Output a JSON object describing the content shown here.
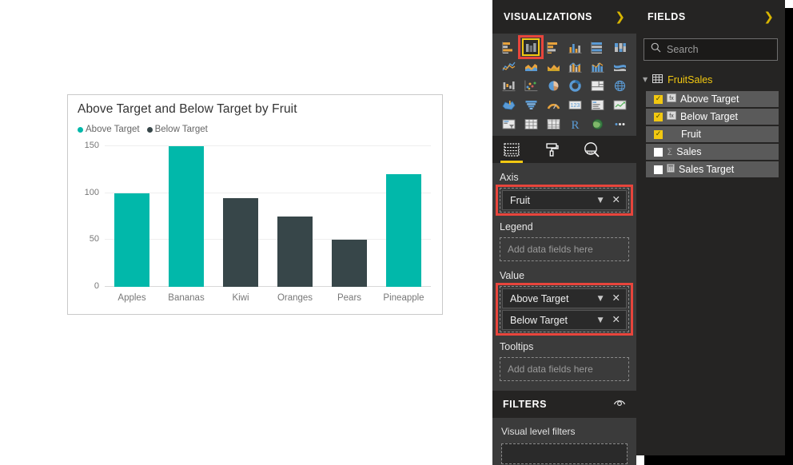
{
  "chart_card": {
    "title": "Above Target and Below Target by Fruit",
    "legend": [
      {
        "label": "Above Target",
        "color": "#01b8aa"
      },
      {
        "label": "Below Target",
        "color": "#374649"
      }
    ]
  },
  "chart_data": {
    "type": "bar",
    "title": "Above Target and Below Target by Fruit",
    "xlabel": "",
    "ylabel": "",
    "categories": [
      "Apples",
      "Bananas",
      "Kiwi",
      "Oranges",
      "Pears",
      "Pineapple"
    ],
    "values": [
      100,
      150,
      95,
      75,
      50,
      120
    ],
    "point_series": [
      "Above Target",
      "Above Target",
      "Below Target",
      "Below Target",
      "Below Target",
      "Above Target"
    ],
    "series": [
      {
        "name": "Above Target",
        "color": "#01b8aa",
        "values": [
          100,
          150,
          null,
          null,
          null,
          120
        ]
      },
      {
        "name": "Below Target",
        "color": "#374649",
        "values": [
          null,
          null,
          95,
          75,
          50,
          null
        ]
      }
    ],
    "ylim": [
      0,
      150
    ],
    "yticks": [
      0,
      50,
      100,
      150
    ],
    "ytick_labels": [
      "0",
      "50",
      "100",
      "150"
    ],
    "grid": true,
    "legend_position": "top-left"
  },
  "visualizations": {
    "header": "VISUALIZATIONS",
    "expand_icon": "chevron-right-icon",
    "selected_index": 1,
    "selected_name": "clustered-column-chart",
    "icons": [
      "stacked-bar-chart",
      "clustered-column-chart",
      "clustered-bar-chart",
      "stacked-column-chart",
      "hundred-percent-stacked-bar-chart",
      "hundred-percent-stacked-column-chart",
      "line-chart",
      "area-chart",
      "stacked-area-chart",
      "line-and-stacked-column-chart",
      "line-and-clustered-column-chart",
      "ribbon-chart",
      "waterfall-chart",
      "scatter-chart",
      "pie-chart",
      "donut-chart",
      "treemap",
      "map",
      "filled-map",
      "funnel",
      "gauge",
      "card",
      "multi-row-card",
      "kpi",
      "slicer",
      "table",
      "matrix",
      "r-script-visual",
      "arcgis-map",
      "more-options"
    ],
    "well_tabs": [
      {
        "name": "fields-tab",
        "icon": "fields-icon",
        "active": true
      },
      {
        "name": "format-tab",
        "icon": "paint-roller-icon",
        "active": false
      },
      {
        "name": "analytics-tab",
        "icon": "analytics-magnifier-icon",
        "active": false
      }
    ],
    "wells": [
      {
        "label": "Axis",
        "highlighted": true,
        "items": [
          {
            "name": "Fruit",
            "caret": "chevron-down-icon",
            "remove": "✕"
          }
        ],
        "placeholder": ""
      },
      {
        "label": "Legend",
        "highlighted": false,
        "items": [],
        "placeholder": "Add data fields here"
      },
      {
        "label": "Value",
        "highlighted": true,
        "items": [
          {
            "name": "Above Target",
            "caret": "chevron-down-icon",
            "remove": "✕"
          },
          {
            "name": "Below Target",
            "caret": "chevron-down-icon",
            "remove": "✕"
          }
        ],
        "placeholder": ""
      },
      {
        "label": "Tooltips",
        "highlighted": false,
        "items": [],
        "placeholder": "Add data fields here"
      }
    ]
  },
  "filters": {
    "header": "FILTERS",
    "eye_icon": "filters-eye-icon",
    "subtitle": "Visual level filters"
  },
  "fields": {
    "header": "FIELDS",
    "expand_icon": "chevron-right-icon",
    "search_placeholder": "Search",
    "search_icon": "search-icon",
    "table": {
      "name": "FruitSales",
      "expander": "triangle-down-icon",
      "table_icon": "table-icon",
      "items": [
        {
          "name": "Above Target",
          "checked": true,
          "type_icon": "calculated-measure-icon"
        },
        {
          "name": "Below Target",
          "checked": true,
          "type_icon": "calculated-measure-icon"
        },
        {
          "name": "Fruit",
          "checked": true,
          "type_icon": "none"
        },
        {
          "name": "Sales",
          "checked": false,
          "type_icon": "sigma-icon"
        },
        {
          "name": "Sales Target",
          "checked": false,
          "type_icon": "calculator-icon"
        }
      ]
    }
  },
  "colors": {
    "accent_yellow": "#f2c811",
    "annotation_red": "#e8453c",
    "series_above": "#01b8aa",
    "series_below": "#374649",
    "panel_dark": "#252423",
    "panel_mid": "#3b3b3b"
  }
}
